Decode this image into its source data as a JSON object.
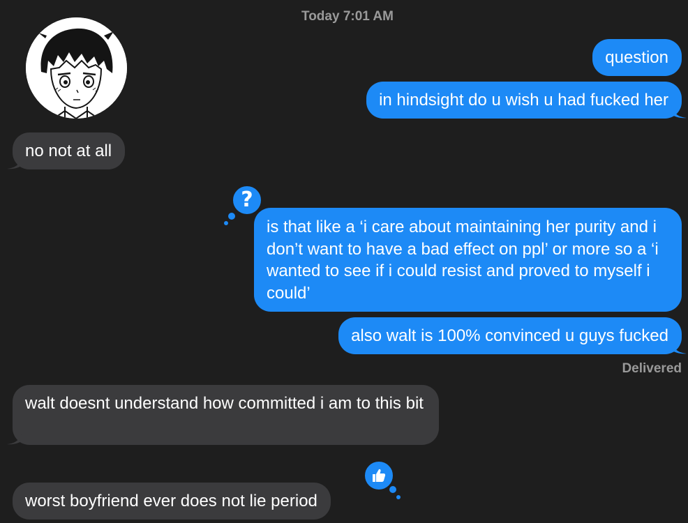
{
  "header": {
    "timestamp": "Today 7:01 AM"
  },
  "contact": {
    "avatar_icon": "anime-character-avatar"
  },
  "messages": [
    {
      "id": 1,
      "direction": "outgoing",
      "text": "question"
    },
    {
      "id": 2,
      "direction": "outgoing",
      "text": "in hindsight do u wish u had fucked her"
    },
    {
      "id": 3,
      "direction": "incoming",
      "text": "no not at all"
    },
    {
      "id": 4,
      "direction": "outgoing",
      "text": "is that like a ‘i care about maintaining her purity and i don’t want to have a bad effect on ppl’ or more so a ‘i wanted to see if i could resist and proved to myself i could’",
      "tapback": "question-mark-icon"
    },
    {
      "id": 5,
      "direction": "outgoing",
      "text": "also walt is 100% convinced u guys fucked"
    },
    {
      "id": 6,
      "direction": "incoming",
      "text": "walt doesnt understand how committed i am to this bit"
    },
    {
      "id": 7,
      "direction": "incoming",
      "text": "worst boyfriend ever does not lie period",
      "tapback": "thumbs-up-icon"
    }
  ],
  "status": {
    "delivered": "Delivered"
  },
  "colors": {
    "background": "#1e1e1e",
    "outgoing_bubble": "#1d8af6",
    "incoming_bubble": "#3b3b3d",
    "meta_text": "#9a9a9a"
  }
}
